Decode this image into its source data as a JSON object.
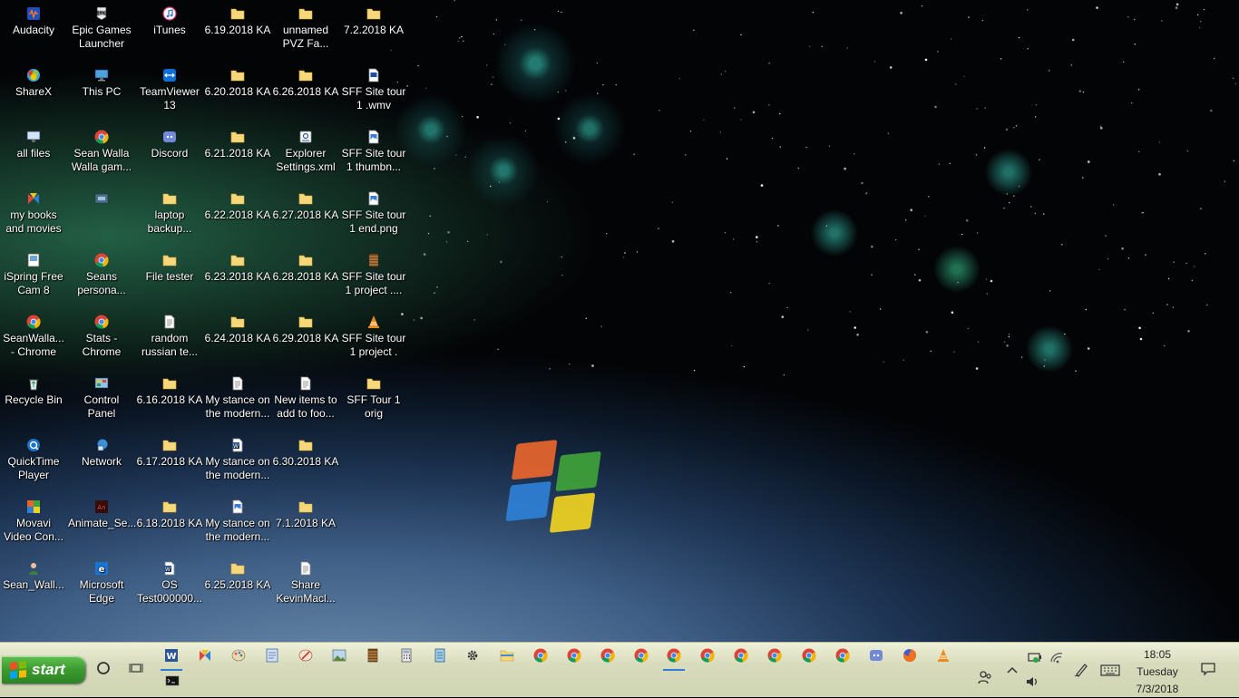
{
  "desktop_icons": [
    {
      "label": "Audacity",
      "icon": "audacity-icon"
    },
    {
      "label": "Epic Games\nLauncher",
      "icon": "epic-games-icon"
    },
    {
      "label": "iTunes",
      "icon": "itunes-icon"
    },
    {
      "label": "6.19.2018 KA",
      "icon": "folder-icon"
    },
    {
      "label": "unnamed\nPVZ Fa...",
      "icon": "folder-icon"
    },
    {
      "label": "7.2.2018 KA",
      "icon": "folder-icon"
    },
    {
      "label": "ShareX",
      "icon": "sharex-icon"
    },
    {
      "label": "This PC",
      "icon": "this-pc-icon"
    },
    {
      "label": "TeamViewer\n13",
      "icon": "teamviewer-icon"
    },
    {
      "label": "6.20.2018 KA",
      "icon": "folder-icon"
    },
    {
      "label": "6.26.2018 KA",
      "icon": "folder-icon"
    },
    {
      "label": "SFF Site tour\n1 .wmv",
      "icon": "video-file-icon"
    },
    {
      "label": "all files",
      "icon": "monitor-shortcut-icon"
    },
    {
      "label": "Sean Walla\nWalla gam...",
      "icon": "chrome-icon"
    },
    {
      "label": "Discord",
      "icon": "discord-shortcut-icon"
    },
    {
      "label": "6.21.2018 KA",
      "icon": "folder-icon"
    },
    {
      "label": "Explorer\nSettings.xml",
      "icon": "xml-file-icon"
    },
    {
      "label": "SFF Site tour\n1 thumbn...",
      "icon": "image-file-icon"
    },
    {
      "label": "my books\nand movies",
      "icon": "library-icon"
    },
    {
      "label": "",
      "icon": "shortcut-icon"
    },
    {
      "label": "laptop\nbackup...",
      "icon": "folder-icon"
    },
    {
      "label": "6.22.2018 KA",
      "icon": "folder-icon"
    },
    {
      "label": "6.27.2018 KA",
      "icon": "folder-icon"
    },
    {
      "label": "SFF Site tour\n1 end.png",
      "icon": "image-file-icon"
    },
    {
      "label": "iSpring Free\nCam 8",
      "icon": "ispring-icon"
    },
    {
      "label": "Seans\npersona...",
      "icon": "chrome-icon"
    },
    {
      "label": "File tester",
      "icon": "folder-icon"
    },
    {
      "label": "6.23.2018 KA",
      "icon": "folder-icon"
    },
    {
      "label": "6.28.2018 KA",
      "icon": "folder-icon"
    },
    {
      "label": "SFF Site tour\n1 project ....",
      "icon": "project-file-icon"
    },
    {
      "label": "SeanWalla...\n- Chrome",
      "icon": "chrome-icon"
    },
    {
      "label": "Stats -\nChrome",
      "icon": "chrome-icon"
    },
    {
      "label": "random\nrussian te...",
      "icon": "text-file-icon"
    },
    {
      "label": "6.24.2018 KA",
      "icon": "folder-icon"
    },
    {
      "label": "6.29.2018 KA",
      "icon": "folder-icon"
    },
    {
      "label": "SFF Site tour\n1 project .",
      "icon": "vlc-file-icon"
    },
    {
      "label": "Recycle Bin",
      "icon": "recycle-bin-icon"
    },
    {
      "label": "Control\nPanel",
      "icon": "control-panel-icon"
    },
    {
      "label": "6.16.2018 KA",
      "icon": "folder-icon"
    },
    {
      "label": "My stance on\nthe modern...",
      "icon": "text-file-icon"
    },
    {
      "label": "New items to\nadd to foo...",
      "icon": "text-file-icon"
    },
    {
      "label": "SFF Tour 1\norig",
      "icon": "folder-icon"
    },
    {
      "label": "QuickTime\nPlayer",
      "icon": "quicktime-icon"
    },
    {
      "label": "Network",
      "icon": "network-icon"
    },
    {
      "label": "6.17.2018 KA",
      "icon": "folder-icon"
    },
    {
      "label": "My stance on\nthe modern...",
      "icon": "word-file-icon"
    },
    {
      "label": "6.30.2018 KA",
      "icon": "folder-icon"
    },
    {
      "label": "Movavi\nVideo Con...",
      "icon": "movavi-icon"
    },
    {
      "label": "Animate_Se...",
      "icon": "animate-file-icon"
    },
    {
      "label": "6.18.2018 KA",
      "icon": "folder-icon"
    },
    {
      "label": "My stance on\nthe modern...",
      "icon": "image-file-icon"
    },
    {
      "label": "7.1.2018 KA",
      "icon": "folder-icon"
    },
    {
      "label": "Sean_Wall...",
      "icon": "user-shortcut-icon"
    },
    {
      "label": "Microsoft\nEdge",
      "icon": "edge-icon"
    },
    {
      "label": "OS\nTest000000...",
      "icon": "word-file-icon"
    },
    {
      "label": "6.25.2018 KA",
      "icon": "folder-icon"
    },
    {
      "label": "Share\nKevinMacl...",
      "icon": "text-file-icon"
    }
  ],
  "taskbar": {
    "start_label": "start",
    "pinned": [
      {
        "name": "cortana-icon"
      },
      {
        "name": "task-view-icon"
      },
      {
        "name": "word-icon"
      },
      {
        "name": "app-icon"
      },
      {
        "name": "paint-icon"
      },
      {
        "name": "document-icon"
      },
      {
        "name": "paint-brush-icon"
      },
      {
        "name": "image-editor-icon"
      },
      {
        "name": "film-icon"
      },
      {
        "name": "calculator-icon"
      },
      {
        "name": "notepad-icon"
      },
      {
        "name": "settings-icon"
      },
      {
        "name": "file-explorer-icon"
      },
      {
        "name": "chrome-icon"
      },
      {
        "name": "chrome-icon"
      },
      {
        "name": "chrome-icon"
      },
      {
        "name": "chrome-icon"
      },
      {
        "name": "chrome-icon"
      },
      {
        "name": "chrome-icon"
      },
      {
        "name": "chrome-icon"
      },
      {
        "name": "chrome-icon"
      },
      {
        "name": "chrome-icon"
      },
      {
        "name": "chrome-icon"
      },
      {
        "name": "discord-icon"
      },
      {
        "name": "firefox-icon"
      },
      {
        "name": "vlc-icon"
      }
    ],
    "clock": {
      "time": "18:05",
      "day": "Tuesday",
      "date": "7/3/2018"
    }
  },
  "colors": {
    "folder": "#f6d77a",
    "chrome_red": "#db4437",
    "chrome_green": "#0f9d58",
    "chrome_yellow": "#f4b400",
    "chrome_blue": "#4285f4",
    "taskbar": "#d8dcbd",
    "start_green": "#3a9a2e"
  }
}
